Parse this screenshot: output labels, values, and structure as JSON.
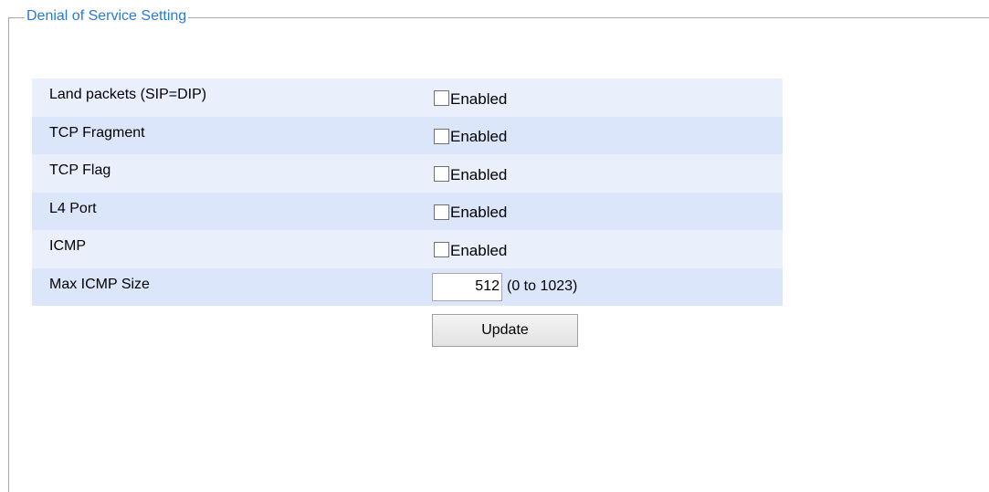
{
  "fieldset": {
    "legend": "Denial of Service Setting"
  },
  "rows": [
    {
      "label": "Land packets (SIP=DIP)",
      "checkbox_label": "Enabled",
      "checked": false
    },
    {
      "label": "TCP Fragment",
      "checkbox_label": "Enabled",
      "checked": false
    },
    {
      "label": "TCP Flag",
      "checkbox_label": "Enabled",
      "checked": false
    },
    {
      "label": "L4 Port",
      "checkbox_label": "Enabled",
      "checked": false
    },
    {
      "label": "ICMP",
      "checkbox_label": "Enabled",
      "checked": false
    }
  ],
  "max_icmp": {
    "label": "Max ICMP Size",
    "value": "512",
    "range": "(0 to 1023)"
  },
  "update_button": "Update",
  "colors": {
    "legend_text": "#2a7ad6",
    "row_light": "#e9effb",
    "row_dark": "#dbe6fb",
    "frame_border": "#a8a8a8"
  }
}
